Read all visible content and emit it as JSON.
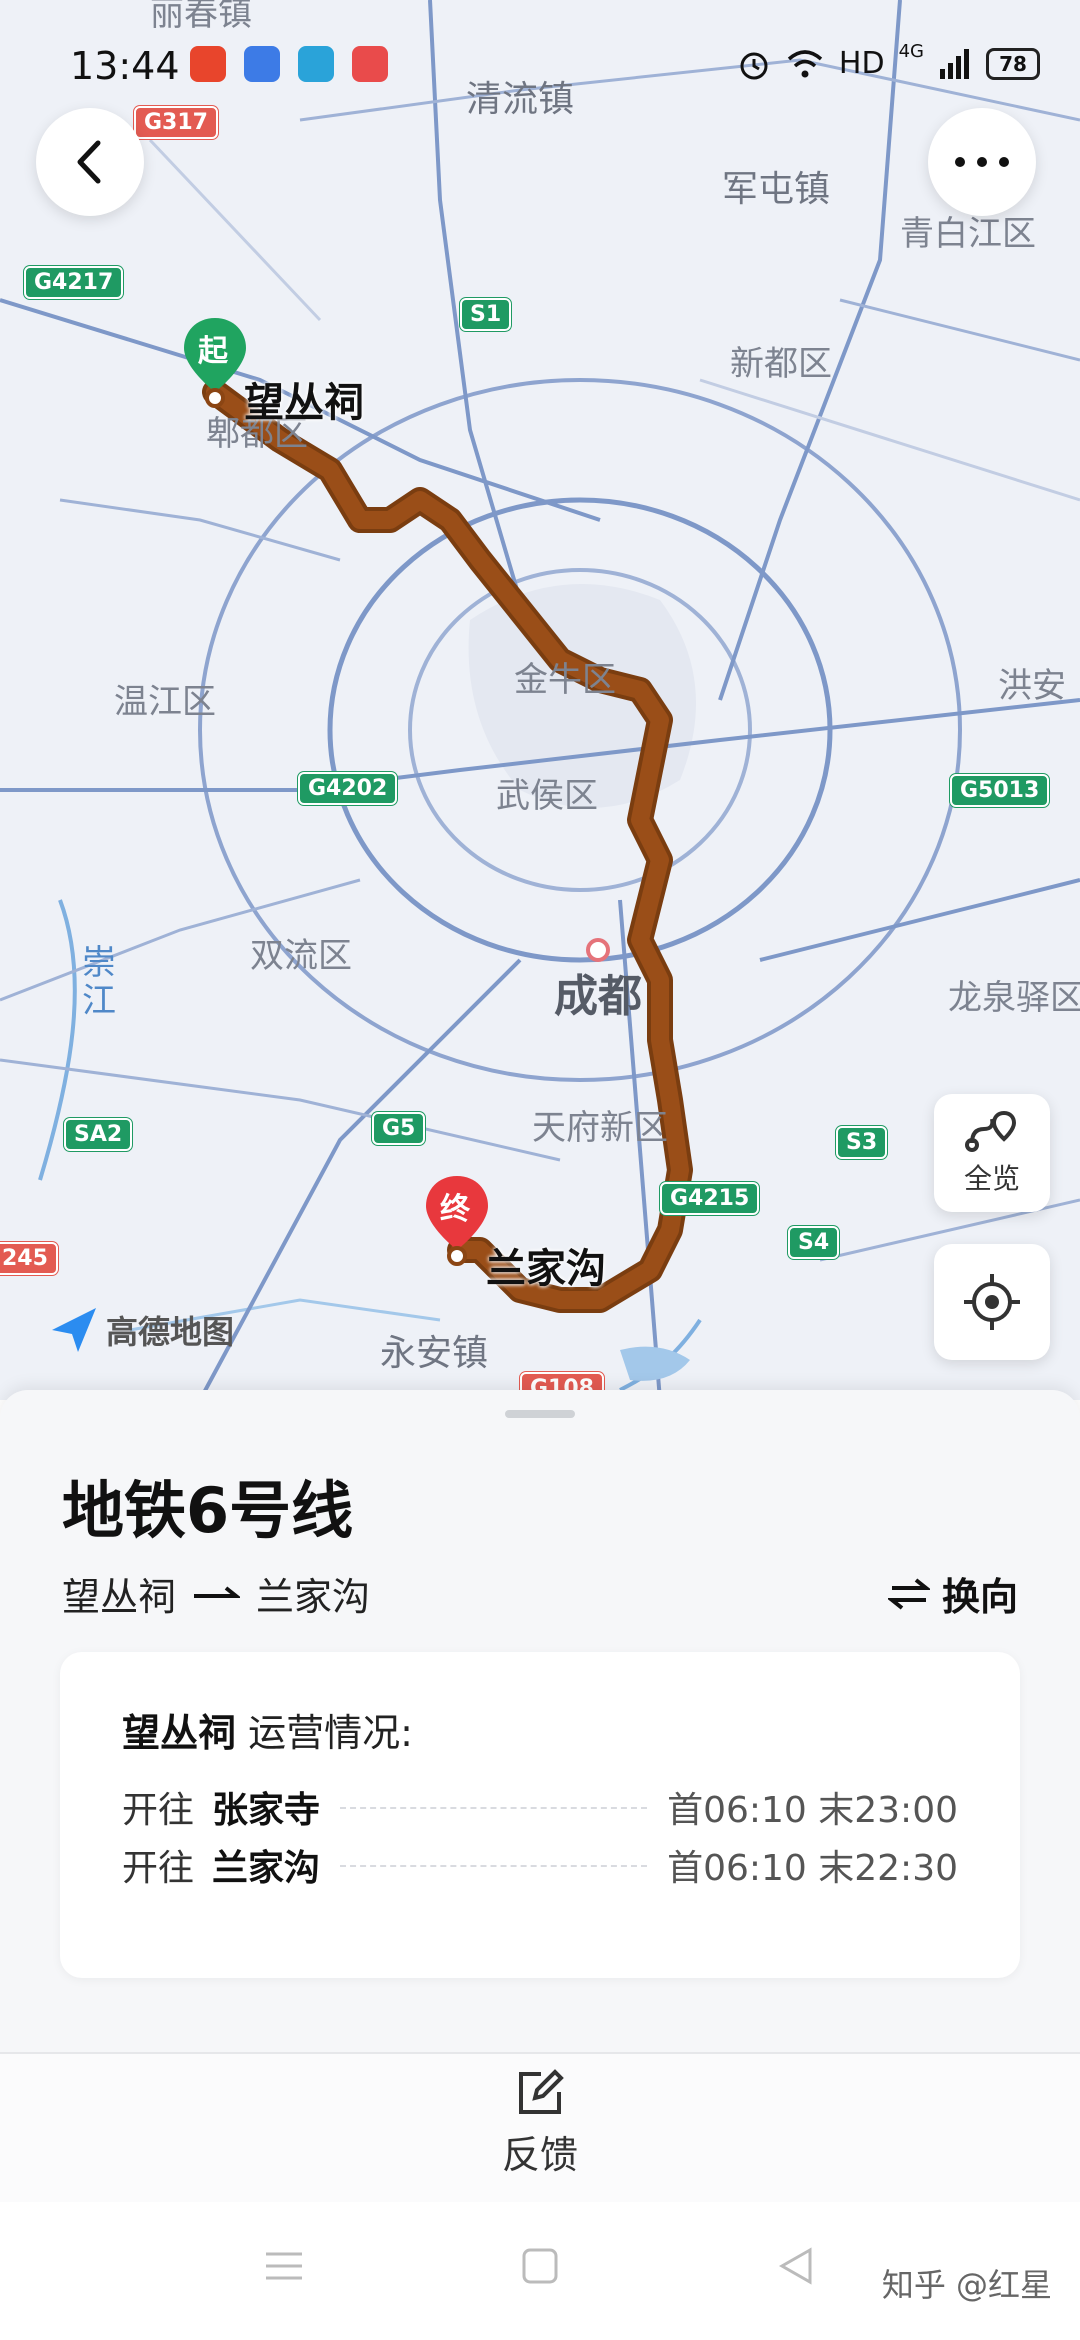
{
  "status_bar": {
    "time": "13:44",
    "network": "HD",
    "signal_type": "4G",
    "battery": "78",
    "icons": [
      "taobao-icon",
      "app-icon",
      "telegram-icon",
      "notes-icon",
      "alarm-icon",
      "wifi-icon",
      "signal-icon",
      "battery-icon"
    ]
  },
  "map": {
    "cities": [
      {
        "name": "成都"
      }
    ],
    "districts": [
      "清流镇",
      "军屯镇",
      "青白江区",
      "新都区",
      "郫都区",
      "温江区",
      "金牛区",
      "武侯区",
      "双流区",
      "天府新区",
      "龙泉驿区",
      "洪安",
      "永安镇",
      "崇江",
      "丽春镇"
    ],
    "roads": [
      "G317",
      "G4217",
      "S1",
      "G4202",
      "G5013",
      "G5",
      "SA2",
      "S3",
      "G4215",
      "S4",
      "G108",
      "245"
    ],
    "start": {
      "marker": "起",
      "name": "望丛祠"
    },
    "end": {
      "marker": "终",
      "name": "兰家沟"
    },
    "logo": "高德地图",
    "overview_label": "全览",
    "route_color": "#8b4513"
  },
  "sheet": {
    "line_name": "地铁6号线",
    "from": "望丛祠",
    "to": "兰家沟",
    "swap_label": "换向",
    "status_station": "望丛祠",
    "status_suffix": "运营情况:",
    "directions": [
      {
        "prefix": "开往",
        "dest": "张家寺",
        "times": "首06:10 末23:00"
      },
      {
        "prefix": "开往",
        "dest": "兰家沟",
        "times": "首06:10 末22:30"
      }
    ],
    "feedback_label": "反馈"
  },
  "watermark": "知乎 @红星"
}
